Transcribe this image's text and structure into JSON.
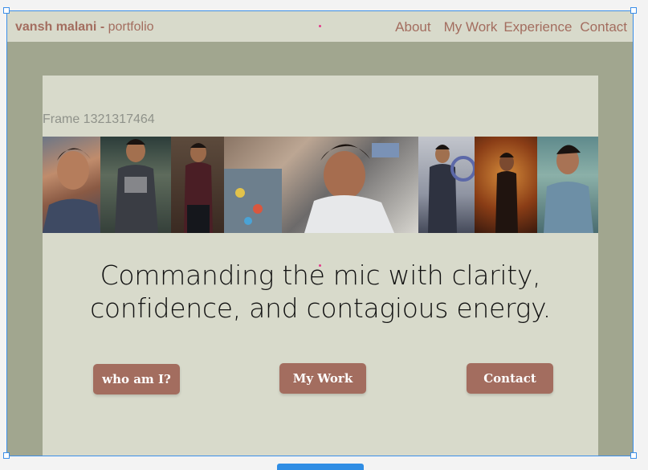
{
  "brand": {
    "name": "vansh malani -",
    "suffix": "portfolio"
  },
  "nav": {
    "items": [
      {
        "label": "About"
      },
      {
        "label": "My Work"
      },
      {
        "label": "Experience"
      },
      {
        "label": "Contact"
      }
    ]
  },
  "frame_label": "Frame 1321317464",
  "hero": {
    "headline_line1": "Commanding the mic with clarity,",
    "headline_line2": "confidence, and contagious energy."
  },
  "buttons": {
    "who": "who am I?",
    "work": "My Work",
    "contact": "Contact"
  },
  "colors": {
    "accent": "#a36d5f",
    "background": "#a1a68f",
    "panel": "#d8dacb",
    "selection": "#3b8ee8"
  }
}
